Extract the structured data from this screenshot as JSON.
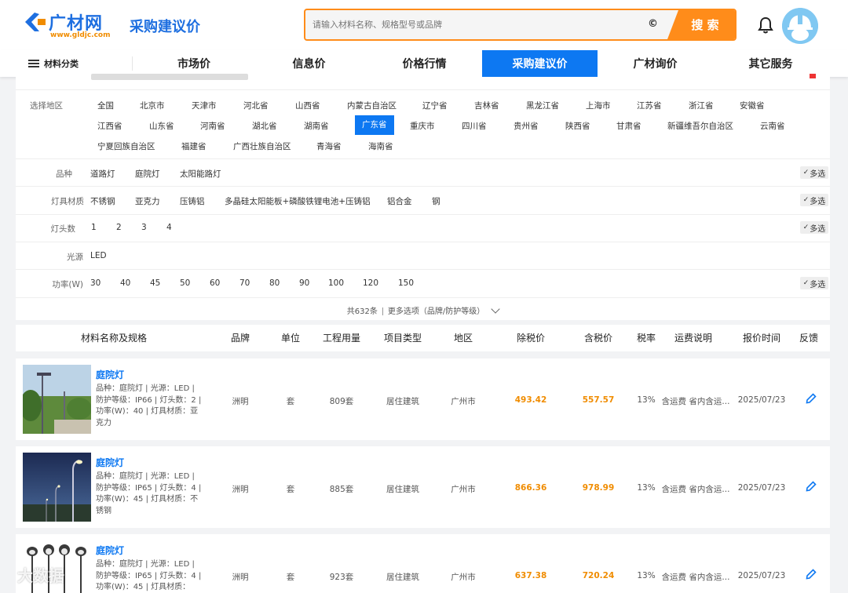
{
  "header": {
    "logo_text": "广材网",
    "logo_url": "www.gldjc.com",
    "site_subtitle": "采购建议价",
    "search_placeholder": "请输入材料名称、规格型号或品牌",
    "search_button": "搜 索",
    "clear_icon": "©"
  },
  "nav": {
    "category_label": "材料分类",
    "items": [
      "市场价",
      "信息价",
      "价格行情",
      "采购建议价",
      "广材询价",
      "其它服务"
    ],
    "active_index": 3
  },
  "filters": {
    "region": {
      "label": "选择地区",
      "row1": [
        "全国",
        "北京市",
        "天津市",
        "河北省",
        "山西省",
        "内蒙古自治区",
        "辽宁省",
        "吉林省",
        "黑龙江省",
        "上海市",
        "江苏省",
        "浙江省",
        "安徽省"
      ],
      "row2": [
        "江西省",
        "山东省",
        "河南省",
        "湖北省",
        "湖南省",
        "广东省",
        "重庆市",
        "四川省",
        "贵州省",
        "陕西省",
        "甘肃省",
        "新疆维吾尔自治区",
        "云南省"
      ],
      "row3": [
        "宁夏回族自治区",
        "福建省",
        "广西壮族自治区",
        "青海省",
        "海南省"
      ],
      "selected": "广东省"
    },
    "variety": {
      "label": "品种",
      "options": [
        "道路灯",
        "庭院灯",
        "太阳能路灯"
      ]
    },
    "material": {
      "label": "灯具材质",
      "options": [
        "不锈钢",
        "亚克力",
        "压铸铝",
        "多晶硅太阳能板+磷酸铁锂电池+压铸铝",
        "铝合金",
        "钢"
      ]
    },
    "heads": {
      "label": "灯头数",
      "options": [
        "1",
        "2",
        "3",
        "4"
      ]
    },
    "source": {
      "label": "光源",
      "options": [
        "LED"
      ]
    },
    "power": {
      "label": "功率(W)",
      "options": [
        "30",
        "40",
        "45",
        "50",
        "60",
        "70",
        "80",
        "90",
        "100",
        "120",
        "150"
      ]
    },
    "multi_label": "多选",
    "summary": "共632条",
    "more_options": "更多选项（品牌/防护等级）"
  },
  "table": {
    "headers": [
      "材料名称及规格",
      "品牌",
      "单位",
      "工程用量",
      "项目类型",
      "地区",
      "除税价",
      "含税价",
      "税率",
      "运费说明",
      "报价时间",
      "反馈"
    ],
    "rows": [
      {
        "name": "庭院灯",
        "desc": "品种：庭院灯 | 光源：LED | 防护等级：IP66 | 灯头数：2 | 功率(W)：40 | 灯具材质：亚克力",
        "brand": "洲明",
        "unit": "套",
        "qty": "809套",
        "type": "居住建筑",
        "region": "广州市",
        "price_ex": "493.42",
        "price_in": "557.57",
        "tax": "13%",
        "freight": "含运费 省内含运...",
        "date": "2025/07/23"
      },
      {
        "name": "庭院灯",
        "desc": "品种：庭院灯 | 光源：LED | 防护等级：IP65 | 灯头数：4 | 功率(W)：45 | 灯具材质：不锈钢",
        "brand": "洲明",
        "unit": "套",
        "qty": "885套",
        "type": "居住建筑",
        "region": "广州市",
        "price_ex": "866.36",
        "price_in": "978.99",
        "tax": "13%",
        "freight": "含运费 省内含运...",
        "date": "2025/07/23"
      },
      {
        "name": "庭院灯",
        "desc": "品种：庭院灯 | 光源：LED | 防护等级：IP65 | 灯头数：4 | 功率(W)：45 | 灯具材质：",
        "brand": "洲明",
        "unit": "套",
        "qty": "923套",
        "type": "居住建筑",
        "region": "广州市",
        "price_ex": "637.38",
        "price_in": "720.24",
        "tax": "13%",
        "freight": "含运费 省内含运...",
        "date": "2025/07/23"
      }
    ]
  },
  "watermark": "大数据"
}
